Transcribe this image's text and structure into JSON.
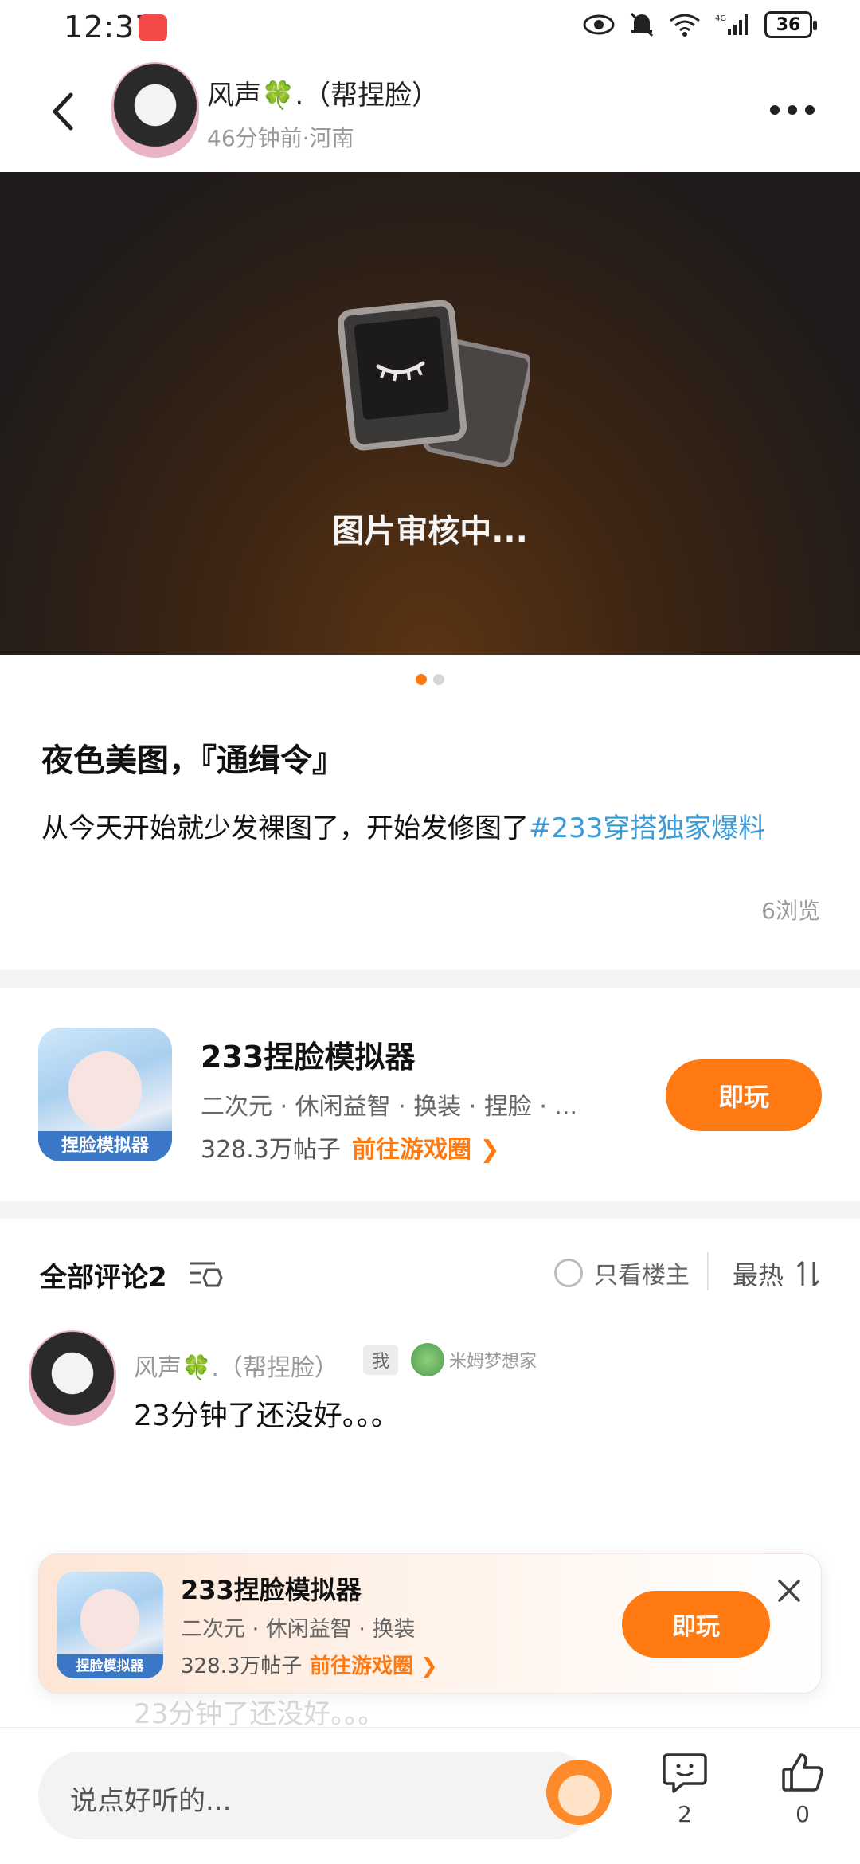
{
  "status_bar": {
    "time": "12:37",
    "battery": "36",
    "network": "4G"
  },
  "header": {
    "author_name": "风声🍀.（帮捏脸）",
    "author_meta": "46分钟前·河南"
  },
  "image": {
    "review_text": "图片审核中..."
  },
  "post": {
    "title": "夜色美图，『通缉令』",
    "body": "从今天开始就少发裸图了，开始发修图了",
    "tag": "#233穿搭独家爆料",
    "views": "6浏览"
  },
  "game_card": {
    "name": "233捏脸模拟器",
    "tags": "二次元 · 休闲益智 · 换装 · 捏脸 · ...",
    "posts": "328.3万帖子",
    "link": "前往游戏圈 ❯",
    "play": "即玩",
    "icon_label": "捏脸模拟器"
  },
  "comments": {
    "title": "全部评论2",
    "only_poster": "只看楼主",
    "sort": "最热",
    "items": [
      {
        "name": "风声🍀.（帮捏脸）",
        "me_badge": "我",
        "fan_badge": "米姆梦想家",
        "text": "23分钟了还没好。。。"
      }
    ]
  },
  "floating_banner": {
    "name": "233捏脸模拟器",
    "tags": "二次元 · 休闲益智 · 换装",
    "posts": "328.3万帖子",
    "link": "前往游戏圈 ❯",
    "play": "即玩",
    "icon_label": "捏脸模拟器"
  },
  "ghost_comment": "23分钟了还没好。。。",
  "bottom_bar": {
    "input_placeholder": "说点好听的...",
    "reply_count": "2",
    "like_count": "0"
  },
  "colors": {
    "accent": "#ff7a12",
    "tag": "#3a9bd8"
  }
}
